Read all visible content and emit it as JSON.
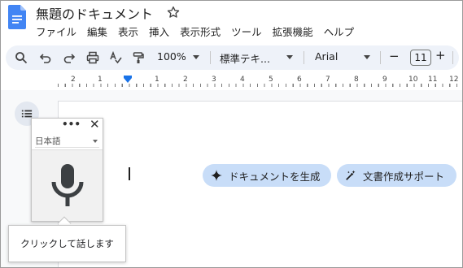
{
  "document": {
    "title": "無題のドキュメント"
  },
  "menubar": {
    "items": [
      "ファイル",
      "編集",
      "表示",
      "挿入",
      "表示形式",
      "ツール",
      "拡張機能",
      "ヘルプ"
    ]
  },
  "toolbar": {
    "zoom": "100%",
    "style": "標準テキ...",
    "font": "Arial",
    "font_size": "11",
    "decrease_label": "−",
    "increase_label": "+"
  },
  "ruler": {
    "labels": [
      "2",
      "1",
      "1",
      "2",
      "3",
      "4",
      "5",
      "6",
      "7",
      "8",
      "9",
      "10",
      "11",
      "12"
    ]
  },
  "ai_chips": {
    "generate_label": "ドキュメントを生成",
    "writing_label": "文書作成サポート"
  },
  "voice_typing": {
    "more_label": "•••",
    "close_label": "✕",
    "language": "日本語",
    "hint": "クリックして話します"
  },
  "colors": {
    "accent": "#1a73e8",
    "toolbar_bg": "#eef2f9",
    "chip_bg": "#c8ddf8"
  }
}
